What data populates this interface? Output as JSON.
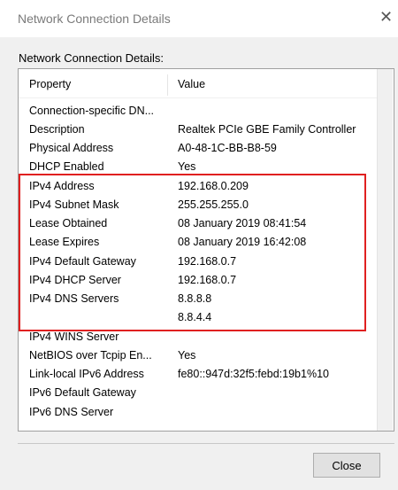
{
  "window": {
    "title": "Network Connection Details",
    "close_glyph": "✕"
  },
  "group_label": "Network Connection Details:",
  "columns": {
    "property": "Property",
    "value": "Value"
  },
  "rows": [
    {
      "property": "Connection-specific DN...",
      "value": ""
    },
    {
      "property": "Description",
      "value": "Realtek PCIe GBE Family Controller"
    },
    {
      "property": "Physical Address",
      "value": "A0-48-1C-BB-B8-59"
    },
    {
      "property": "DHCP Enabled",
      "value": "Yes"
    },
    {
      "property": "IPv4 Address",
      "value": "192.168.0.209"
    },
    {
      "property": "IPv4 Subnet Mask",
      "value": "255.255.255.0"
    },
    {
      "property": "Lease Obtained",
      "value": "08 January 2019 08:41:54"
    },
    {
      "property": "Lease Expires",
      "value": "08 January 2019 16:42:08"
    },
    {
      "property": "IPv4 Default Gateway",
      "value": "192.168.0.7"
    },
    {
      "property": "IPv4 DHCP Server",
      "value": "192.168.0.7"
    },
    {
      "property": "IPv4 DNS Servers",
      "value": "8.8.8.8"
    },
    {
      "property": "",
      "value": "8.8.4.4"
    },
    {
      "property": "IPv4 WINS Server",
      "value": ""
    },
    {
      "property": "NetBIOS over Tcpip En...",
      "value": "Yes"
    },
    {
      "property": "Link-local IPv6 Address",
      "value": "fe80::947d:32f5:febd:19b1%10"
    },
    {
      "property": "IPv6 Default Gateway",
      "value": ""
    },
    {
      "property": "IPv6 DNS Server",
      "value": ""
    }
  ],
  "close_button": "Close",
  "annotation_color": "#e02020"
}
